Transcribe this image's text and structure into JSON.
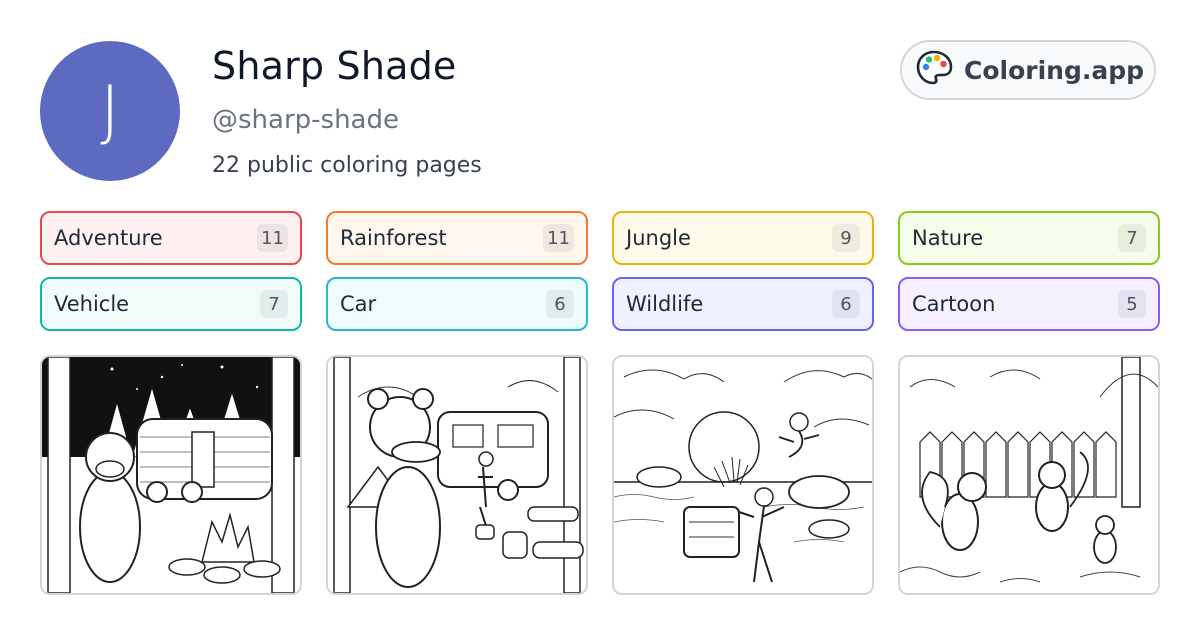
{
  "profile": {
    "avatar_initial": "J",
    "name": "Sharp Shade",
    "handle": "@sharp-shade",
    "count_text": "22 public coloring pages"
  },
  "brand": {
    "label": "Coloring.app",
    "icon": "palette-icon"
  },
  "tags": [
    {
      "label": "Adventure",
      "count": "11",
      "color": "#e5484d",
      "bg": "#fff1f1"
    },
    {
      "label": "Rainforest",
      "count": "11",
      "color": "#f07c2e",
      "bg": "#fff6ee"
    },
    {
      "label": "Jungle",
      "count": "9",
      "color": "#eab308",
      "bg": "#fffbea"
    },
    {
      "label": "Nature",
      "count": "7",
      "color": "#84cc16",
      "bg": "#f6fdea"
    },
    {
      "label": "Vehicle",
      "count": "7",
      "color": "#14b8a6",
      "bg": "#effcfa"
    },
    {
      "label": "Car",
      "count": "6",
      "color": "#22b8cf",
      "bg": "#eefcfe"
    },
    {
      "label": "Wildlife",
      "count": "6",
      "color": "#6366f1",
      "bg": "#f0f1fe"
    },
    {
      "label": "Cartoon",
      "count": "5",
      "color": "#8b5cf6",
      "bg": "#f5f1fe"
    }
  ],
  "thumbnails": [
    {
      "subject": "night-campsite-platypus-coloring-page"
    },
    {
      "subject": "campsite-platypus-costume-coloring-page"
    },
    {
      "subject": "ocean-platypus-whales-coloring-page"
    },
    {
      "subject": "backyard-squirrels-coloring-page"
    }
  ]
}
